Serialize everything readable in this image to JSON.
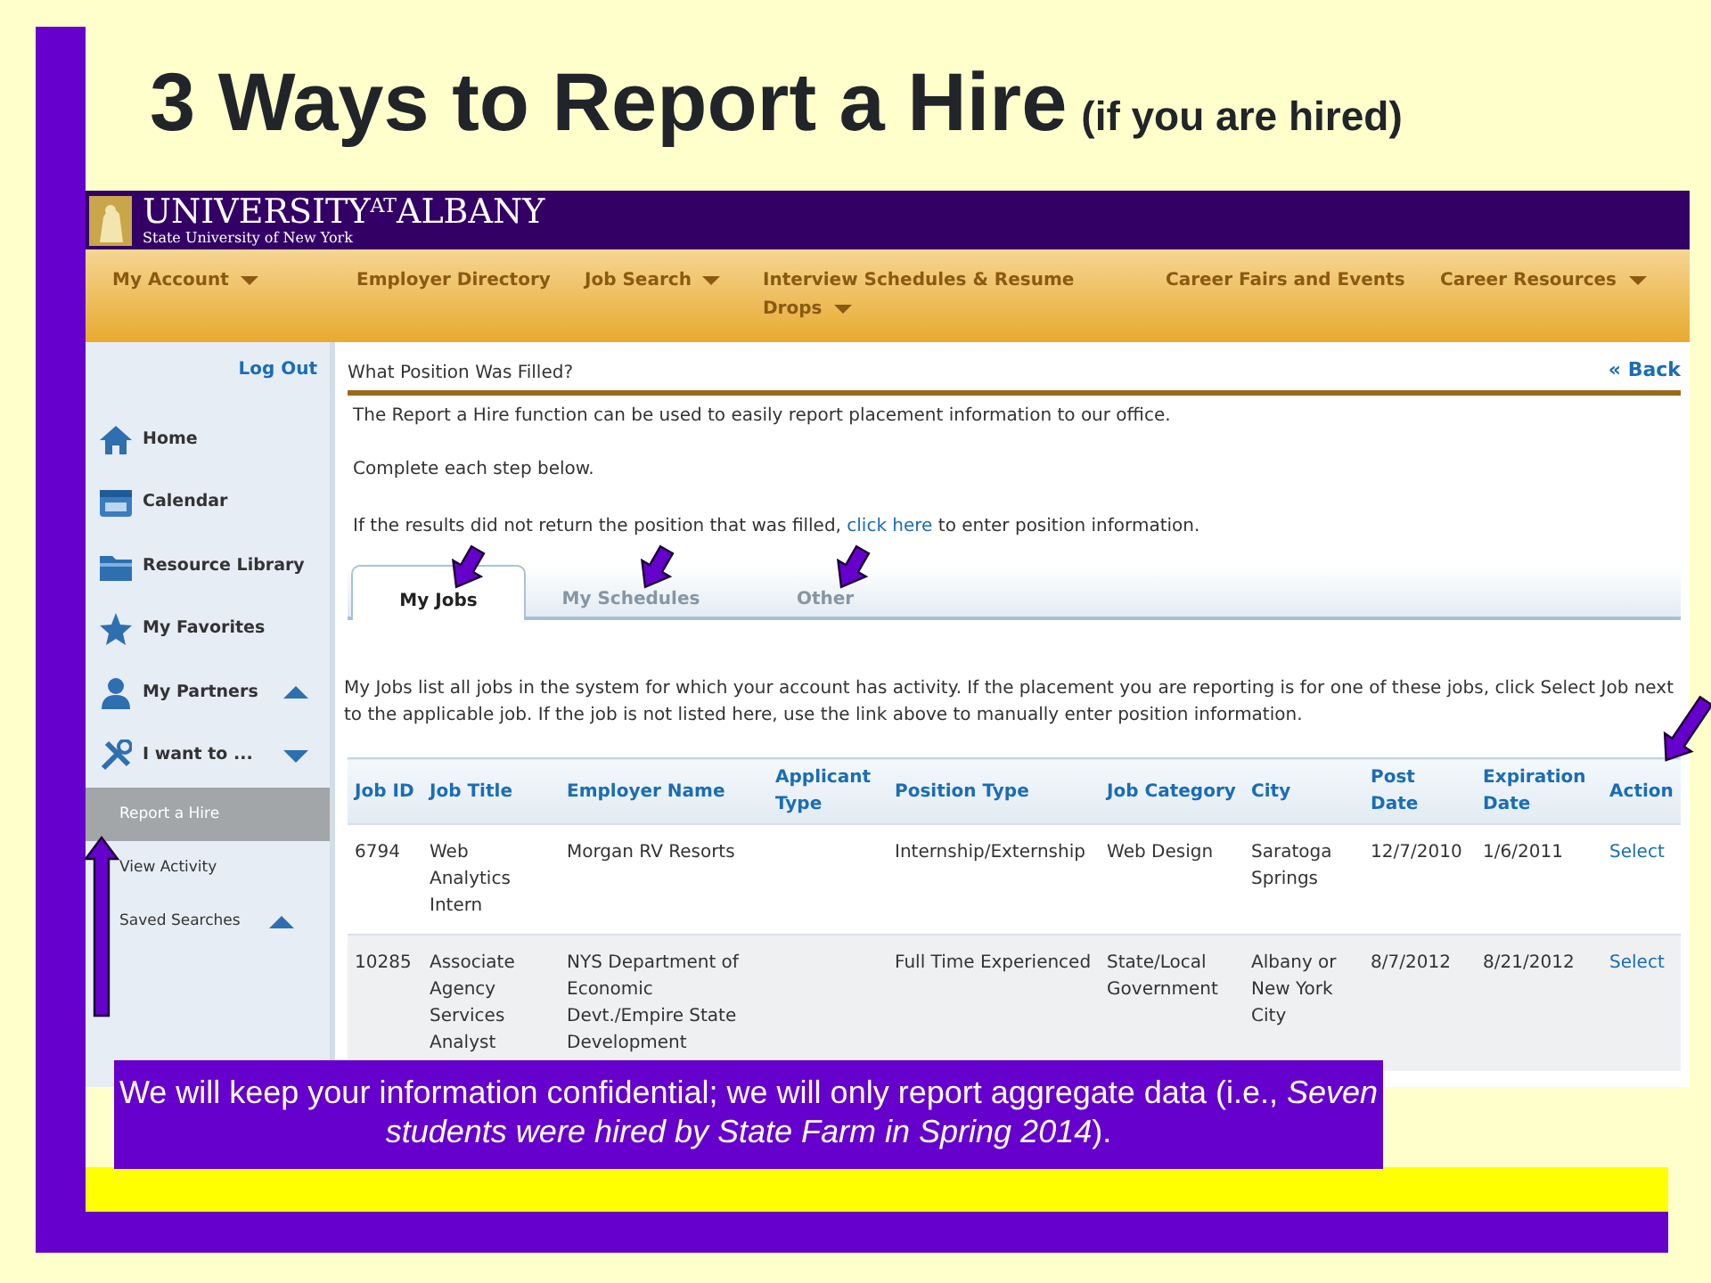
{
  "slide": {
    "title": "3 Ways to Report a Hire",
    "subtitle": "(if you are hired)",
    "caption": "We will keep your information confidential; we will only report aggregate data (i.e., *Seven students were hired by State Farm in Spring 2014*)."
  },
  "header": {
    "logo_main": "UNIVERSITY",
    "logo_small": "AT",
    "logo_end": "ALBANY",
    "logo_sub": "State University of New York"
  },
  "nav": [
    {
      "label": "My Account",
      "dropdown": true
    },
    {
      "label": "Employer Directory",
      "dropdown": false
    },
    {
      "label": "Job Search",
      "dropdown": true
    },
    {
      "label": "Interview Schedules & Resume Drops",
      "dropdown": true
    },
    {
      "label": "Career Fairs and Events",
      "dropdown": false
    },
    {
      "label": "Career Resources",
      "dropdown": true
    }
  ],
  "sidebar": {
    "logout": "Log Out",
    "items": [
      {
        "kind": "home",
        "label": "Home"
      },
      {
        "kind": "calendar",
        "label": "Calendar"
      },
      {
        "kind": "folder",
        "label": "Resource Library"
      },
      {
        "kind": "star",
        "label": "My Favorites"
      },
      {
        "kind": "person",
        "label": "My Partners",
        "arrow_up": true
      },
      {
        "kind": "tools",
        "label": "I want to ...",
        "arrow_up": false
      }
    ],
    "subitems": [
      {
        "label": "Report a Hire",
        "selected": true
      },
      {
        "label": "View Activity",
        "selected": false
      },
      {
        "label": "Saved Searches",
        "selected": false,
        "arrow_up": true
      }
    ]
  },
  "content": {
    "heading": "What Position Was Filled?",
    "back": "« Back",
    "intro": "The Report a Hire function can be used to easily report placement information to our office.",
    "step": "Complete each step below.",
    "manual_before": "If the results did not return the position that was filled, ",
    "manual_link": "click here",
    "manual_after": " to enter position information.",
    "tabs": [
      {
        "label": "My Jobs",
        "selected": true
      },
      {
        "label": "My Schedules",
        "selected": false
      },
      {
        "label": "Other",
        "selected": false
      }
    ],
    "description": "My Jobs list all jobs in the system for which your account has activity.  If the placement you are reporting is for one of these jobs, click Select Job next to the applicable job.  If the job is not listed here, use the link above to manually enter position information."
  },
  "table": {
    "columns": [
      "Job ID",
      "Job Title",
      "Employer Name",
      "Applicant Type",
      "Position Type",
      "Job Category",
      "City",
      "Post Date",
      "Expiration Date",
      "Action"
    ],
    "rows": [
      [
        "6794",
        "Web Analytics Intern",
        "Morgan RV Resorts",
        "",
        "Internship/Externship",
        "Web Design",
        "Saratoga Springs",
        "12/7/2010",
        "1/6/2011",
        "Select"
      ],
      [
        "10285",
        "Associate Agency Services Analyst",
        "NYS Department of Economic Devt./Empire State Development",
        "",
        "Full Time Experienced",
        "State/Local Government",
        "Albany or New York City",
        "8/7/2012",
        "8/21/2012",
        "Select"
      ]
    ]
  }
}
